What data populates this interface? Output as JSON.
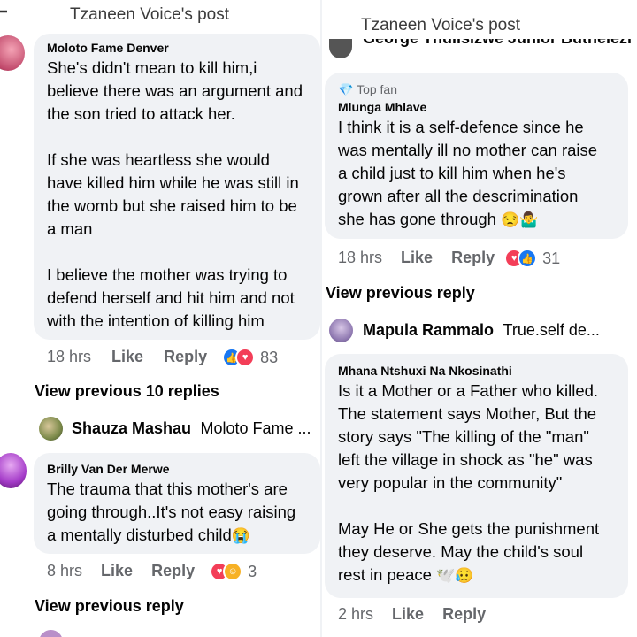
{
  "left": {
    "header": "Tzaneen Voice's post",
    "comment1": {
      "author": "Moloto Fame Denver",
      "lines": [
        "She's didn't mean to kill him,i",
        "believe there was an argument and",
        "the son tried to attack her.",
        "",
        "If she was heartless she would",
        "have killed him while he was still in",
        "the womb  but she raised him to be",
        "a man",
        "",
        "I believe the mother was trying to",
        "defend herself and hit him and not",
        "with the intention of killing him"
      ],
      "time": "18 hrs",
      "like": "Like",
      "reply": "Reply",
      "reactions": "83"
    },
    "view_previous": "View previous 10 replies",
    "collapsed_reply": {
      "author": "Shauza Mashau",
      "snippet": "Moloto Fame ..."
    },
    "comment2": {
      "author": "Brilly Van Der Merwe",
      "lines": [
        "The trauma that this mother's are",
        "going through..It's not easy raising",
        "a mentally disturbed child"
      ],
      "emoji": "😭",
      "time": "8 hrs",
      "like": "Like",
      "reply": "Reply",
      "reactions": "3"
    },
    "view_previous_reply": "View previous reply"
  },
  "right": {
    "header": "Tzaneen Voice's post",
    "cut_name": "George Thulisizwe Junior Buthelezi",
    "comment1": {
      "badge": "Top fan",
      "author": "Mlunga Mhlave",
      "lines": [
        "I think it is a self-defence since he",
        "was mentally ill no mother can raise",
        "a child just to kill him when he's",
        "grown after all the descrimination",
        "she has gone through"
      ],
      "emoji": "😒🤷‍♂️",
      "time": "18 hrs",
      "like": "Like",
      "reply": "Reply",
      "reactions": "31"
    },
    "view_previous_reply": "View previous reply",
    "collapsed_reply": {
      "author": "Mapula Rammalo",
      "snippet": "True.self de..."
    },
    "comment2": {
      "author": "Mhana Ntshuxi Na Nkosinathi",
      "lines": [
        "Is it a Mother or a Father who killed.",
        "The statement says Mother, But the",
        "story says \"The killing of the \"man\"",
        "left the village in shock as \"he\" was",
        "very popular in the community\"",
        "",
        "May He or She gets the punishment",
        "they deserve. May the child's soul",
        "rest in peace"
      ],
      "emoji": "🕊️😥",
      "time": "2 hrs",
      "like": "Like",
      "reply": "Reply"
    }
  }
}
